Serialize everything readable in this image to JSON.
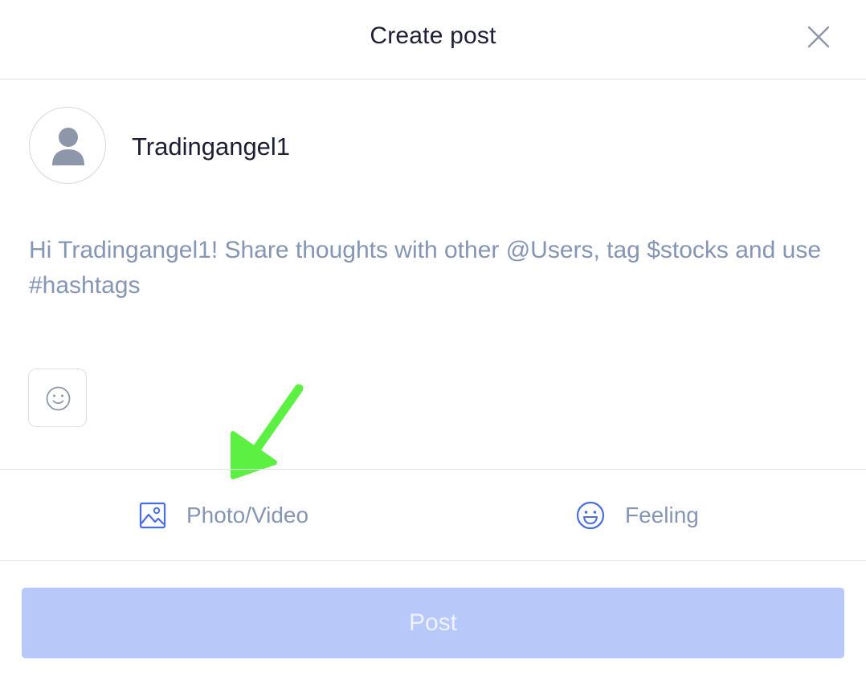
{
  "header": {
    "title": "Create post",
    "close_icon": "close-icon"
  },
  "user": {
    "name": "Tradingangel1",
    "avatar_icon": "user-silhouette-icon"
  },
  "composer": {
    "placeholder": "Hi Tradingangel1! Share thoughts with other @Users, tag $stocks and use #hashtags"
  },
  "emoji_button": {
    "icon": "smiley-icon"
  },
  "annotation": {
    "icon": "green-arrow-annotation",
    "color": "#5cf043"
  },
  "actions": [
    {
      "label": "Photo/Video",
      "icon": "image-icon"
    },
    {
      "label": "Feeling",
      "icon": "smiley-face-icon"
    }
  ],
  "post_button": {
    "label": "Post",
    "state": "disabled"
  },
  "colors": {
    "accent_blue": "#4a6ee0",
    "post_button_disabled": "#b8c8f8",
    "placeholder_text": "#8595b4"
  }
}
